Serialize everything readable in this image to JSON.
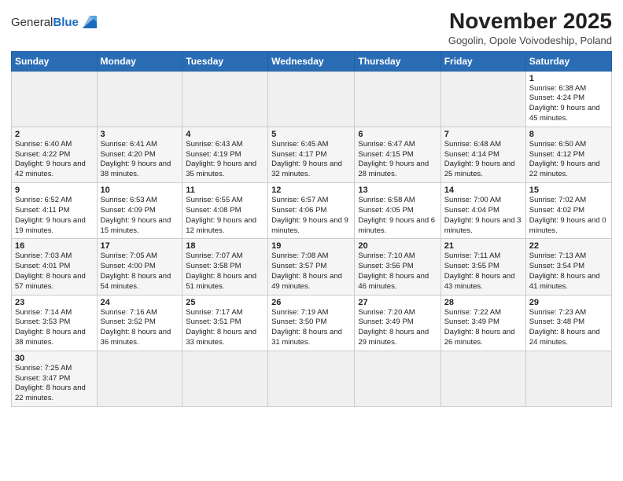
{
  "header": {
    "logo_general": "General",
    "logo_blue": "Blue",
    "month_title": "November 2025",
    "location": "Gogolin, Opole Voivodeship, Poland"
  },
  "weekdays": [
    "Sunday",
    "Monday",
    "Tuesday",
    "Wednesday",
    "Thursday",
    "Friday",
    "Saturday"
  ],
  "weeks": [
    [
      {
        "day": "",
        "info": ""
      },
      {
        "day": "",
        "info": ""
      },
      {
        "day": "",
        "info": ""
      },
      {
        "day": "",
        "info": ""
      },
      {
        "day": "",
        "info": ""
      },
      {
        "day": "",
        "info": ""
      },
      {
        "day": "1",
        "info": "Sunrise: 6:38 AM\nSunset: 4:24 PM\nDaylight: 9 hours and 45 minutes."
      }
    ],
    [
      {
        "day": "2",
        "info": "Sunrise: 6:40 AM\nSunset: 4:22 PM\nDaylight: 9 hours and 42 minutes."
      },
      {
        "day": "3",
        "info": "Sunrise: 6:41 AM\nSunset: 4:20 PM\nDaylight: 9 hours and 38 minutes."
      },
      {
        "day": "4",
        "info": "Sunrise: 6:43 AM\nSunset: 4:19 PM\nDaylight: 9 hours and 35 minutes."
      },
      {
        "day": "5",
        "info": "Sunrise: 6:45 AM\nSunset: 4:17 PM\nDaylight: 9 hours and 32 minutes."
      },
      {
        "day": "6",
        "info": "Sunrise: 6:47 AM\nSunset: 4:15 PM\nDaylight: 9 hours and 28 minutes."
      },
      {
        "day": "7",
        "info": "Sunrise: 6:48 AM\nSunset: 4:14 PM\nDaylight: 9 hours and 25 minutes."
      },
      {
        "day": "8",
        "info": "Sunrise: 6:50 AM\nSunset: 4:12 PM\nDaylight: 9 hours and 22 minutes."
      }
    ],
    [
      {
        "day": "9",
        "info": "Sunrise: 6:52 AM\nSunset: 4:11 PM\nDaylight: 9 hours and 19 minutes."
      },
      {
        "day": "10",
        "info": "Sunrise: 6:53 AM\nSunset: 4:09 PM\nDaylight: 9 hours and 15 minutes."
      },
      {
        "day": "11",
        "info": "Sunrise: 6:55 AM\nSunset: 4:08 PM\nDaylight: 9 hours and 12 minutes."
      },
      {
        "day": "12",
        "info": "Sunrise: 6:57 AM\nSunset: 4:06 PM\nDaylight: 9 hours and 9 minutes."
      },
      {
        "day": "13",
        "info": "Sunrise: 6:58 AM\nSunset: 4:05 PM\nDaylight: 9 hours and 6 minutes."
      },
      {
        "day": "14",
        "info": "Sunrise: 7:00 AM\nSunset: 4:04 PM\nDaylight: 9 hours and 3 minutes."
      },
      {
        "day": "15",
        "info": "Sunrise: 7:02 AM\nSunset: 4:02 PM\nDaylight: 9 hours and 0 minutes."
      }
    ],
    [
      {
        "day": "16",
        "info": "Sunrise: 7:03 AM\nSunset: 4:01 PM\nDaylight: 8 hours and 57 minutes."
      },
      {
        "day": "17",
        "info": "Sunrise: 7:05 AM\nSunset: 4:00 PM\nDaylight: 8 hours and 54 minutes."
      },
      {
        "day": "18",
        "info": "Sunrise: 7:07 AM\nSunset: 3:58 PM\nDaylight: 8 hours and 51 minutes."
      },
      {
        "day": "19",
        "info": "Sunrise: 7:08 AM\nSunset: 3:57 PM\nDaylight: 8 hours and 49 minutes."
      },
      {
        "day": "20",
        "info": "Sunrise: 7:10 AM\nSunset: 3:56 PM\nDaylight: 8 hours and 46 minutes."
      },
      {
        "day": "21",
        "info": "Sunrise: 7:11 AM\nSunset: 3:55 PM\nDaylight: 8 hours and 43 minutes."
      },
      {
        "day": "22",
        "info": "Sunrise: 7:13 AM\nSunset: 3:54 PM\nDaylight: 8 hours and 41 minutes."
      }
    ],
    [
      {
        "day": "23",
        "info": "Sunrise: 7:14 AM\nSunset: 3:53 PM\nDaylight: 8 hours and 38 minutes."
      },
      {
        "day": "24",
        "info": "Sunrise: 7:16 AM\nSunset: 3:52 PM\nDaylight: 8 hours and 36 minutes."
      },
      {
        "day": "25",
        "info": "Sunrise: 7:17 AM\nSunset: 3:51 PM\nDaylight: 8 hours and 33 minutes."
      },
      {
        "day": "26",
        "info": "Sunrise: 7:19 AM\nSunset: 3:50 PM\nDaylight: 8 hours and 31 minutes."
      },
      {
        "day": "27",
        "info": "Sunrise: 7:20 AM\nSunset: 3:49 PM\nDaylight: 8 hours and 29 minutes."
      },
      {
        "day": "28",
        "info": "Sunrise: 7:22 AM\nSunset: 3:49 PM\nDaylight: 8 hours and 26 minutes."
      },
      {
        "day": "29",
        "info": "Sunrise: 7:23 AM\nSunset: 3:48 PM\nDaylight: 8 hours and 24 minutes."
      }
    ],
    [
      {
        "day": "30",
        "info": "Sunrise: 7:25 AM\nSunset: 3:47 PM\nDaylight: 8 hours and 22 minutes."
      },
      {
        "day": "",
        "info": ""
      },
      {
        "day": "",
        "info": ""
      },
      {
        "day": "",
        "info": ""
      },
      {
        "day": "",
        "info": ""
      },
      {
        "day": "",
        "info": ""
      },
      {
        "day": "",
        "info": ""
      }
    ]
  ]
}
